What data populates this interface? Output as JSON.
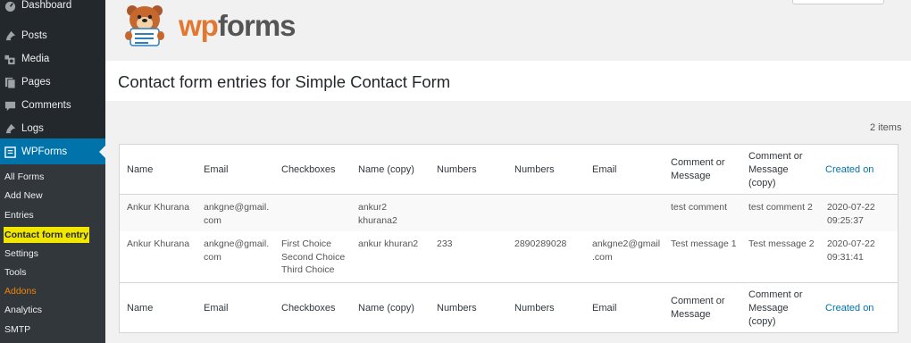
{
  "sidebar": {
    "menu": [
      {
        "label": "Dashboard",
        "icon": "dashboard-icon"
      },
      {
        "label": "Posts",
        "icon": "pin-icon"
      },
      {
        "label": "Media",
        "icon": "media-icon"
      },
      {
        "label": "Pages",
        "icon": "pages-icon"
      },
      {
        "label": "Comments",
        "icon": "comment-icon"
      },
      {
        "label": "Logs",
        "icon": "pin-icon"
      },
      {
        "label": "WPForms",
        "icon": "wpforms-icon"
      }
    ],
    "submenu": [
      "All Forms",
      "Add New",
      "Entries",
      "Contact form entry",
      "Settings",
      "Tools",
      "Addons",
      "Analytics",
      "SMTP"
    ]
  },
  "logo": {
    "wp": "wp",
    "forms": "forms"
  },
  "page_title": "Contact form entries for Simple Contact Form",
  "items_count": "2 items",
  "columns": [
    "Name",
    "Email",
    "Checkboxes",
    "Name (copy)",
    "Numbers",
    "Numbers",
    "Email",
    "Comment or Message",
    "Comment or Message (copy)",
    "Created on"
  ],
  "rows": [
    [
      "Ankur Khurana",
      "ankgne@gmail. com",
      "",
      "ankur2 khurana2",
      "",
      "",
      "",
      "test comment",
      "test comment 2",
      "2020-07-22 09:25:37"
    ],
    [
      "Ankur Khurana",
      "ankgne@gmail. com",
      "First Choice Second Choice Third Choice",
      "ankur khuran2",
      "233",
      "2890289028",
      "ankgne2@gmail .com",
      "Test message 1",
      "Test message 2",
      "2020-07-22 09:31:41"
    ]
  ],
  "colors": {
    "sidebar": "#23282d",
    "submenu": "#32373c",
    "active": "#0073aa",
    "link": "#0073aa",
    "highlight": "#f0e600",
    "addons": "#f18500",
    "wp_orange": "#e27730"
  }
}
